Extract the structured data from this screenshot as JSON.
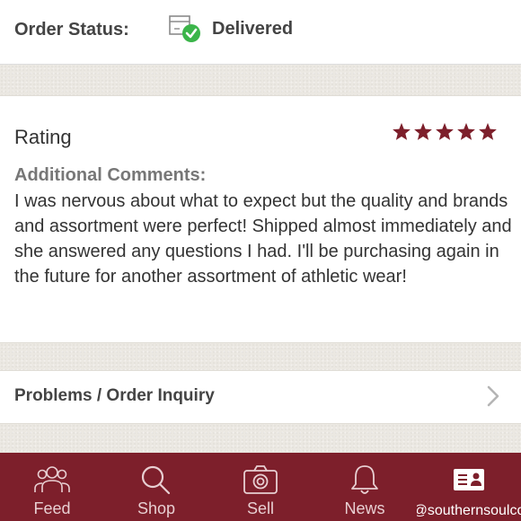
{
  "order_status": {
    "label": "Order Status:",
    "value": "Delivered",
    "icon": "delivered-box-check-icon"
  },
  "rating": {
    "label": "Rating",
    "stars": 5,
    "max_stars": 5,
    "star_color": "#7d1f2b",
    "comments_label": "Additional Comments:",
    "comments_text": "I was nervous about what to expect but the quality and brands and assortment were perfect! Shipped almost immediately and she answered any questions I had. I'll be purchasing again in the future for another assortment of athletic wear!"
  },
  "problems": {
    "label": "Problems / Order Inquiry",
    "icon": "chevron-right-icon"
  },
  "tabbar": {
    "background": "#7d1f2b",
    "active_tab": "account",
    "tabs": [
      {
        "id": "feed",
        "label": "Feed",
        "icon": "people-icon"
      },
      {
        "id": "shop",
        "label": "Shop",
        "icon": "search-icon"
      },
      {
        "id": "sell",
        "label": "Sell",
        "icon": "camera-icon"
      },
      {
        "id": "news",
        "label": "News",
        "icon": "bell-icon"
      },
      {
        "id": "account",
        "label": "@southernsoulco",
        "icon": "id-card-icon"
      }
    ]
  }
}
